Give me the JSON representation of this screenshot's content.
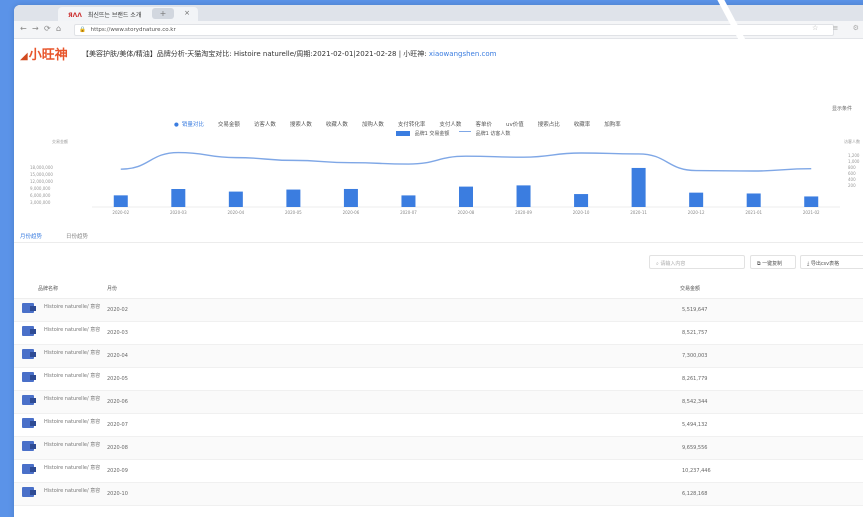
{
  "browser": {
    "tab_title": "최신뜨는 브랜드 소개",
    "tab_logo": "ЯΛΛ",
    "tab_close": "×",
    "new_tab": "+",
    "url": "https://www.storydnature.co.kr"
  },
  "page": {
    "logo_text": "小旺神",
    "title_prefix": "【美容护肤/美体/精油】品牌分析-天猫淘宝对比: Histoire naturelle/周期:2021-02-01|2021-02-28 | 小旺神:",
    "title_link": "xiaowangshen.com",
    "export_label": "显示条件"
  },
  "metric_tabs": [
    "销量对比",
    "交易金额",
    "访客人数",
    "搜索人数",
    "收藏人数",
    "加购人数",
    "支付转化率",
    "支付人数",
    "客单价",
    "uv价值",
    "搜索占比",
    "收藏率",
    "加购率"
  ],
  "legend": {
    "bar_label": "品牌1 交易金额",
    "line_label": "品牌1 访客人数"
  },
  "chart_data": {
    "type": "bar",
    "categories": [
      "2020-02",
      "2020-03",
      "2020-04",
      "2020-05",
      "2020-06",
      "2020-07",
      "2020-08",
      "2020-09",
      "2020-10",
      "2020-11",
      "2020-12",
      "2021-01",
      "2021-02"
    ],
    "series": [
      {
        "name": "品牌1 交易金额",
        "type": "bar",
        "values": [
          5519647,
          8521757,
          7300003,
          8261779,
          8542344,
          5494132,
          9659556,
          10237446,
          6128168,
          18500000,
          6800000,
          6400000,
          5000000
        ]
      },
      {
        "name": "品牌1 访客人数",
        "type": "line",
        "values": [
          820,
          1180,
          1070,
          1010,
          960,
          930,
          1100,
          1080,
          1170,
          1150,
          790,
          780,
          830
        ]
      }
    ],
    "y_left_ticks": [
      "18,000,000",
      "15,000,000",
      "12,000,000",
      "9,000,000",
      "6,000,000",
      "3,000,000"
    ],
    "y_right_ticks": [
      "1,200",
      "1,000",
      "800",
      "600",
      "400",
      "200"
    ],
    "ylabel_left": "交易金额",
    "ylabel_right": "访客人数"
  },
  "sub_tabs": [
    "月份趋势",
    "日份趋势"
  ],
  "tools": {
    "search_placeholder": "请输入内容",
    "copy_label": "一键复制",
    "export_label": "导出csv表格"
  },
  "table": {
    "headers": [
      "品牌名称",
      "月份",
      "交易金额"
    ],
    "rows": [
      {
        "brand": "Histoire naturelle/ 意容",
        "month": "2020-02",
        "sales": "5,519,647"
      },
      {
        "brand": "Histoire naturelle/ 意容",
        "month": "2020-03",
        "sales": "8,521,757"
      },
      {
        "brand": "Histoire naturelle/ 意容",
        "month": "2020-04",
        "sales": "7,300,003"
      },
      {
        "brand": "Histoire naturelle/ 意容",
        "month": "2020-05",
        "sales": "8,261,779"
      },
      {
        "brand": "Histoire naturelle/ 意容",
        "month": "2020-06",
        "sales": "8,542,344"
      },
      {
        "brand": "Histoire naturelle/ 意容",
        "month": "2020-07",
        "sales": "5,494,132"
      },
      {
        "brand": "Histoire naturelle/ 意容",
        "month": "2020-08",
        "sales": "9,659,556"
      },
      {
        "brand": "Histoire naturelle/ 意容",
        "month": "2020-09",
        "sales": "10,237,446"
      },
      {
        "brand": "Histoire naturelle/ 意容",
        "month": "2020-10",
        "sales": "6,128,168"
      }
    ]
  }
}
